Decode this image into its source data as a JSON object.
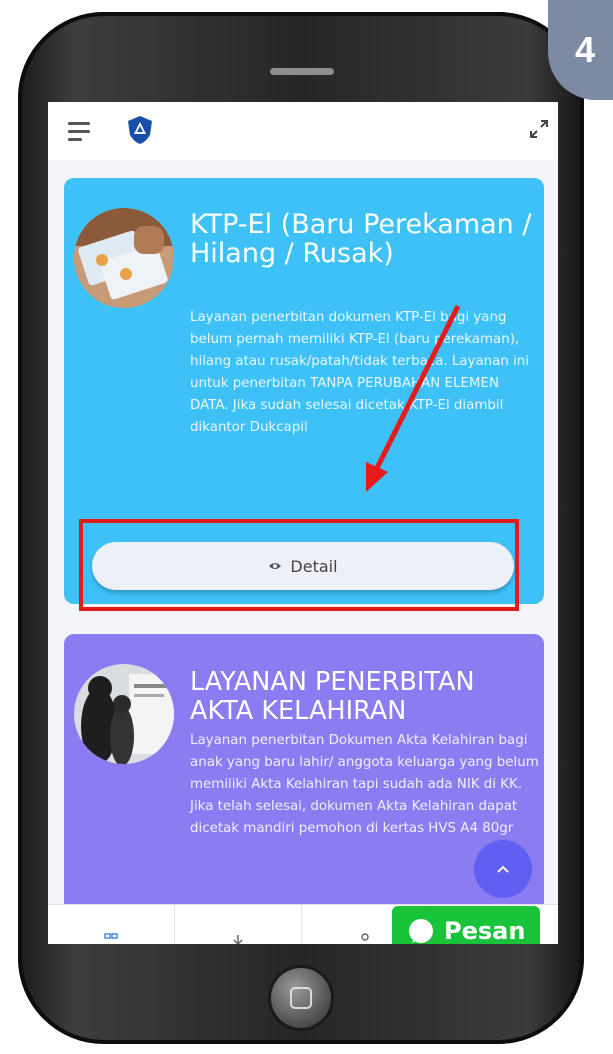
{
  "step": {
    "number": "4"
  },
  "screen": {
    "topbar": {
      "menu_icon": "hamburger-menu-icon",
      "logo_icon": "government-emblem-logo",
      "expand_icon": "expand-arrows-icon"
    },
    "cards": [
      {
        "title": "KTP-El (Baru Perekaman / Hilang / Rusak)",
        "description": "Layanan penerbitan dokumen KTP-El bagi yang belum pernah memiliki KTP-El (baru perekaman), hilang atau rusak/patah/tidak terbaca. Layanan ini untuk penerbitan TANPA PERUBAHAN ELEMEN DATA. Jika sudah selesai dicetak KTP-El diambil dikantor Dukcapil",
        "button_label": "Detail",
        "button_icon": "eye-icon",
        "color": "#3dc1f6"
      },
      {
        "title": "LAYANAN PENERBITAN AKTA KELAHIRAN",
        "description": "Layanan penerbitan Dokumen Akta Kelahiran bagi anak yang baru lahir/ anggota keluarga yang belum memiliki Akta Kelahiran tapi sudah ada NIK di KK. Jika telah selesai, dokumen Akta Kelahiran dapat dicetak mandiri pemohon di kertas HVS A4 80gr",
        "color": "#8b7df1"
      }
    ],
    "scroll_top_icon": "chevron-up-icon",
    "chat_button": {
      "label": "Pesan",
      "icon": "chat-bubble-icon",
      "color": "#19c33a"
    }
  },
  "annotation": {
    "highlight_color": "#e51b1b"
  }
}
